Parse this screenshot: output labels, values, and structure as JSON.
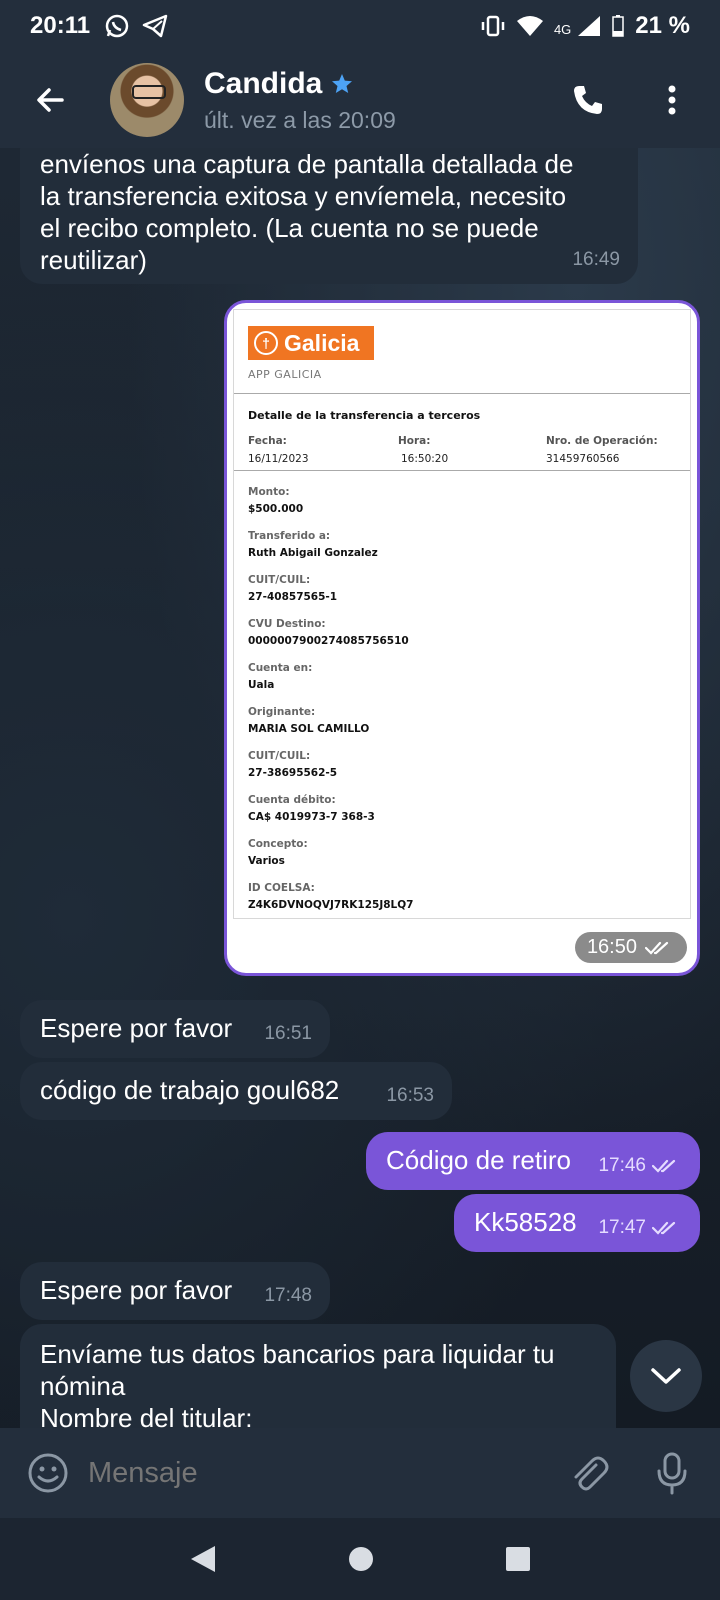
{
  "status_bar": {
    "time": "20:11",
    "network": "4G",
    "battery": "21 %"
  },
  "header": {
    "name": "Candida",
    "last_seen": "últ. vez a las 20:09"
  },
  "messages": [
    {
      "id": "m1",
      "direction": "in",
      "text_lines": [
        "envíenos una captura de pantalla detallada de",
        "la transferencia exitosa y envíemela, necesito",
        "el recibo completo. (La cuenta no se puede",
        "reutilizar)"
      ],
      "time": "16:49"
    },
    {
      "id": "m2",
      "direction": "out",
      "type": "image",
      "time": "16:50"
    },
    {
      "id": "m3",
      "direction": "in",
      "text": "Espere por favor",
      "time": "16:51"
    },
    {
      "id": "m4",
      "direction": "in",
      "text": "código de trabajo goul682",
      "time": "16:53"
    },
    {
      "id": "m5",
      "direction": "out",
      "text": "Código de retiro",
      "time": "17:46"
    },
    {
      "id": "m6",
      "direction": "out",
      "text": "Kk58528",
      "time": "17:47"
    },
    {
      "id": "m7",
      "direction": "in",
      "text": "Espere por favor",
      "time": "17:48"
    },
    {
      "id": "m8",
      "direction": "in",
      "text_lines": [
        "Envíame tus datos bancarios para liquidar tu",
        "nómina",
        "Nombre del titular:"
      ]
    }
  ],
  "receipt": {
    "brand": "Galicia",
    "app_label": "APP GALICIA",
    "title": "Detalle de la transferencia a terceros",
    "fecha_label": "Fecha:",
    "fecha": "16/11/2023",
    "hora_label": "Hora:",
    "hora": "16:50:20",
    "op_label": "Nro. de Operación:",
    "op": "31459760566",
    "fields": [
      {
        "k": "Monto:",
        "v": "$500.000"
      },
      {
        "k": "Transferido a:",
        "v": "Ruth Abigail Gonzalez"
      },
      {
        "k": "CUIT/CUIL:",
        "v": "27-40857565-1"
      },
      {
        "k": "CVU Destino:",
        "v": "0000007900274085756510"
      },
      {
        "k": "Cuenta en:",
        "v": "Uala"
      },
      {
        "k": "Originante:",
        "v": "MARIA SOL CAMILLO"
      },
      {
        "k": "CUIT/CUIL:",
        "v": "27-38695562-5"
      },
      {
        "k": "Cuenta débito:",
        "v": "CA$ 4019973-7 368-3"
      },
      {
        "k": "Concepto:",
        "v": "Varios"
      },
      {
        "k": "ID COELSA:",
        "v": "Z4K6DVNOQVJ7RK125J8LQ7"
      }
    ]
  },
  "input": {
    "placeholder": "Mensaje"
  },
  "colors": {
    "accent": "#7a55d8",
    "bubble_in": "#222d3a",
    "header_bg": "#232e3c",
    "galicia_orange": "#f07522"
  }
}
